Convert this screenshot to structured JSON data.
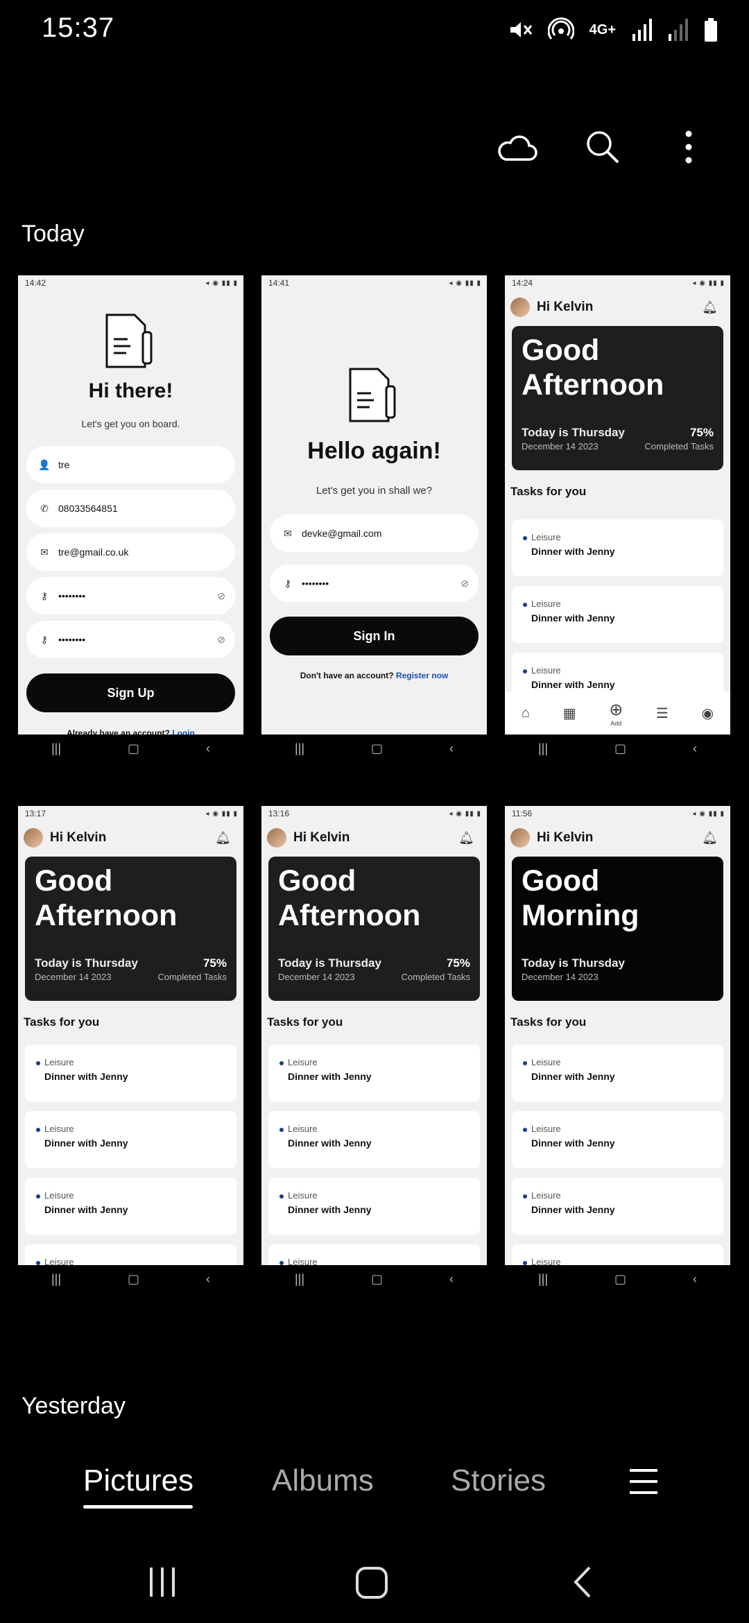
{
  "status_bar": {
    "time": "15:37",
    "network_label": "4G+"
  },
  "sections": {
    "today": "Today",
    "yesterday": "Yesterday"
  },
  "thumbs": {
    "signup": {
      "time": "14:42",
      "title": "Hi there!",
      "subtitle": "Let's get you on board.",
      "fields": [
        "tre",
        "08033564851",
        "tre@gmail.co.uk",
        "••••••••",
        "••••••••"
      ],
      "button": "Sign Up",
      "footer_q": "Already have an account?",
      "footer_link": "Login"
    },
    "signin": {
      "time": "14:41",
      "title": "Hello again!",
      "subtitle": "Let's get you in shall we?",
      "fields": [
        "devke@gmail.com",
        "••••••••"
      ],
      "button": "Sign In",
      "footer_q": "Don't have an account?",
      "footer_link": "Register now"
    },
    "home": {
      "user": "Hi Kelvin",
      "day": "Today is Thursday",
      "date": "December 14 2023",
      "pct": "75%",
      "pct_label": "Completed Tasks",
      "tasks_head": "Tasks for you",
      "task_cat": "Leisure",
      "task_title": "Dinner with Jenny",
      "add_label": "Add"
    },
    "times": [
      "14:24",
      "13:17",
      "13:16",
      "11:56"
    ],
    "greetings": [
      "Good Afternoon",
      "Good Afternoon",
      "Good Afternoon",
      "Good Morning"
    ]
  },
  "tabs": [
    "Pictures",
    "Albums",
    "Stories"
  ]
}
